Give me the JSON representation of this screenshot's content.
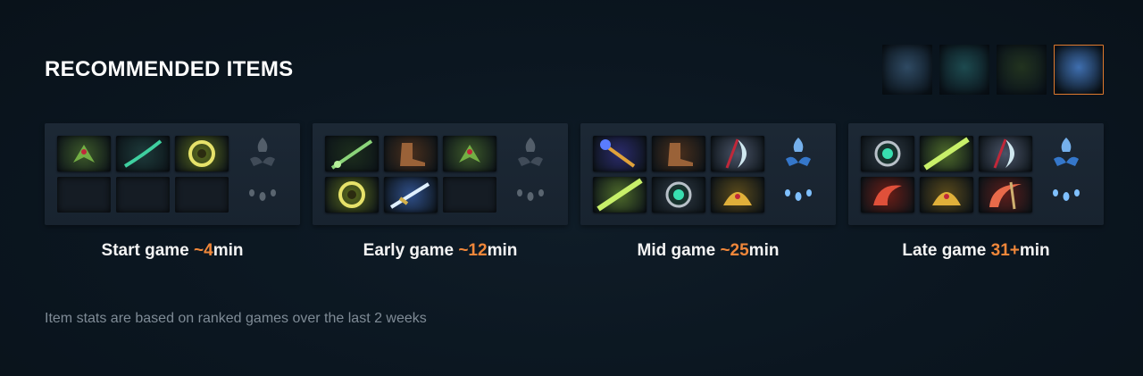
{
  "section_title": "RECOMMENDED ITEMS",
  "facets": [
    {
      "icon": "facet-wave-icon",
      "active": false,
      "color": "#2f4a63"
    },
    {
      "icon": "facet-fountain-icon",
      "active": false,
      "color": "#1d4a4f"
    },
    {
      "icon": "facet-shadow-icon",
      "active": false,
      "color": "#22331f"
    },
    {
      "icon": "facet-hero-icon",
      "active": true,
      "color": "#3f6fb0"
    }
  ],
  "accent_color": "#f0873a",
  "stages": [
    {
      "label_prefix": "Start game ",
      "label_accent": "~4",
      "label_suffix": "min",
      "items": [
        {
          "icon": "mantle-icon",
          "bg": "#3d5a2a"
        },
        {
          "icon": "branch-icon",
          "bg": "#1d3a3a"
        },
        {
          "icon": "orb-icon",
          "bg": "#5a6b1d"
        },
        {
          "icon": "empty-slot",
          "bg": ""
        },
        {
          "icon": "empty-slot",
          "bg": ""
        },
        {
          "icon": "empty-slot",
          "bg": ""
        }
      ],
      "neutral_top": "neutral-token-icon",
      "neutral_bottom": "neutral-drops-icon",
      "neutral_active": false
    },
    {
      "label_prefix": "Early game ",
      "label_accent": "~12",
      "label_suffix": "min",
      "items": [
        {
          "icon": "staff-icon",
          "bg": "#1c2d1c"
        },
        {
          "icon": "boots-icon",
          "bg": "#4a2f1c"
        },
        {
          "icon": "mantle-icon",
          "bg": "#3d5a2a"
        },
        {
          "icon": "orb-icon",
          "bg": "#5a6b1d"
        },
        {
          "icon": "sword-icon",
          "bg": "#2f4f8a"
        },
        {
          "icon": "empty-slot",
          "bg": ""
        }
      ],
      "neutral_top": "neutral-token-icon",
      "neutral_bottom": "neutral-drops-icon",
      "neutral_active": false
    },
    {
      "label_prefix": "Mid game ",
      "label_accent": "~25",
      "label_suffix": "min",
      "items": [
        {
          "icon": "scepter-icon",
          "bg": "#2a2a6b"
        },
        {
          "icon": "boots-icon",
          "bg": "#4a2f1c"
        },
        {
          "icon": "axe-icon",
          "bg": "#4a5468"
        },
        {
          "icon": "blade-icon",
          "bg": "#4e6b2a"
        },
        {
          "icon": "eye-icon",
          "bg": "#2f3a44"
        },
        {
          "icon": "helm-icon",
          "bg": "#5a4a1a"
        }
      ],
      "neutral_top": "neutral-token-icon",
      "neutral_bottom": "neutral-drops-icon",
      "neutral_active": true
    },
    {
      "label_prefix": "Late game ",
      "label_accent": "31+",
      "label_suffix": "min",
      "items": [
        {
          "icon": "eye-icon",
          "bg": "#2f3a44"
        },
        {
          "icon": "blade-icon",
          "bg": "#4e6b2a"
        },
        {
          "icon": "axe-icon",
          "bg": "#4a5468"
        },
        {
          "icon": "claw-icon",
          "bg": "#6b1d16"
        },
        {
          "icon": "helm-icon",
          "bg": "#5a4a1a"
        },
        {
          "icon": "scythe-icon",
          "bg": "#5a1d1a"
        }
      ],
      "neutral_top": "neutral-token-icon",
      "neutral_bottom": "neutral-drops-icon",
      "neutral_active": true
    }
  ],
  "footnote": "Item stats are based on ranked games over the last 2 weeks"
}
